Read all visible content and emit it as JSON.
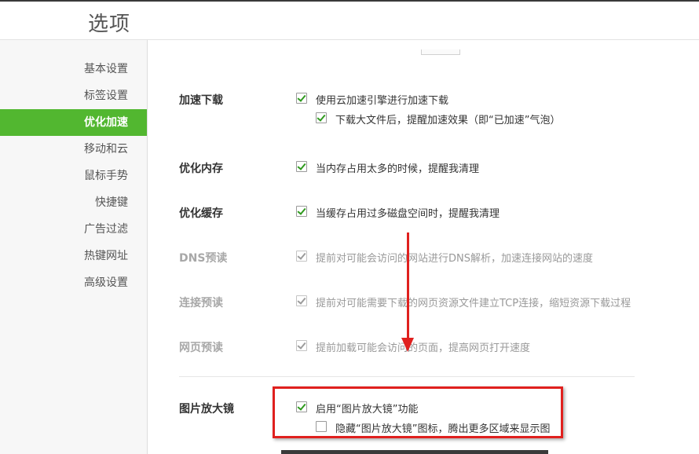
{
  "window": {
    "title": "选项"
  },
  "sidebar": {
    "items": [
      {
        "label": "基本设置",
        "active": false
      },
      {
        "label": "标签设置",
        "active": false
      },
      {
        "label": "优化加速",
        "active": true
      },
      {
        "label": "移动和云",
        "active": false
      },
      {
        "label": "鼠标手势",
        "active": false
      },
      {
        "label": "快捷键",
        "active": false
      },
      {
        "label": "广告过滤",
        "active": false
      },
      {
        "label": "热键网址",
        "active": false
      },
      {
        "label": "高级设置",
        "active": false
      }
    ]
  },
  "sections": {
    "download": {
      "label": "加速下载",
      "opt1": {
        "text": "使用云加速引擎进行加速下载",
        "checked": true
      },
      "opt2": {
        "text": "下载大文件后，提醒加速效果（即“已加速”气泡）",
        "checked": true
      }
    },
    "memory": {
      "label": "优化内存",
      "opt1": {
        "text": "当内存占用太多的时候，提醒我清理",
        "checked": true
      }
    },
    "cache": {
      "label": "优化缓存",
      "opt1": {
        "text": "当缓存占用过多磁盘空间时，提醒我清理",
        "checked": true
      }
    },
    "dns": {
      "label": "DNS预读",
      "opt1": {
        "text": "提前对可能会访问的网站进行DNS解析，加速连接网站的速度",
        "checked": true
      }
    },
    "connect": {
      "label": "连接预读",
      "opt1": {
        "text": "提前对可能需要下载的网页资源文件建立TCP连接，缩短资源下载过程",
        "checked": true
      }
    },
    "page": {
      "label": "网页预读",
      "opt1": {
        "text": "提前加载可能会访问的页面，提高网页打开速度",
        "checked": true
      }
    },
    "magnifier": {
      "label": "图片放大镜",
      "opt1": {
        "text": "启用“图片放大镜”功能",
        "checked": true
      },
      "opt2": {
        "text": "隐藏“图片放大镜”图标，腾出更多区域来显示图",
        "checked": false
      }
    }
  },
  "colors": {
    "accent": "#52b730",
    "annotation": "#e0201e"
  }
}
